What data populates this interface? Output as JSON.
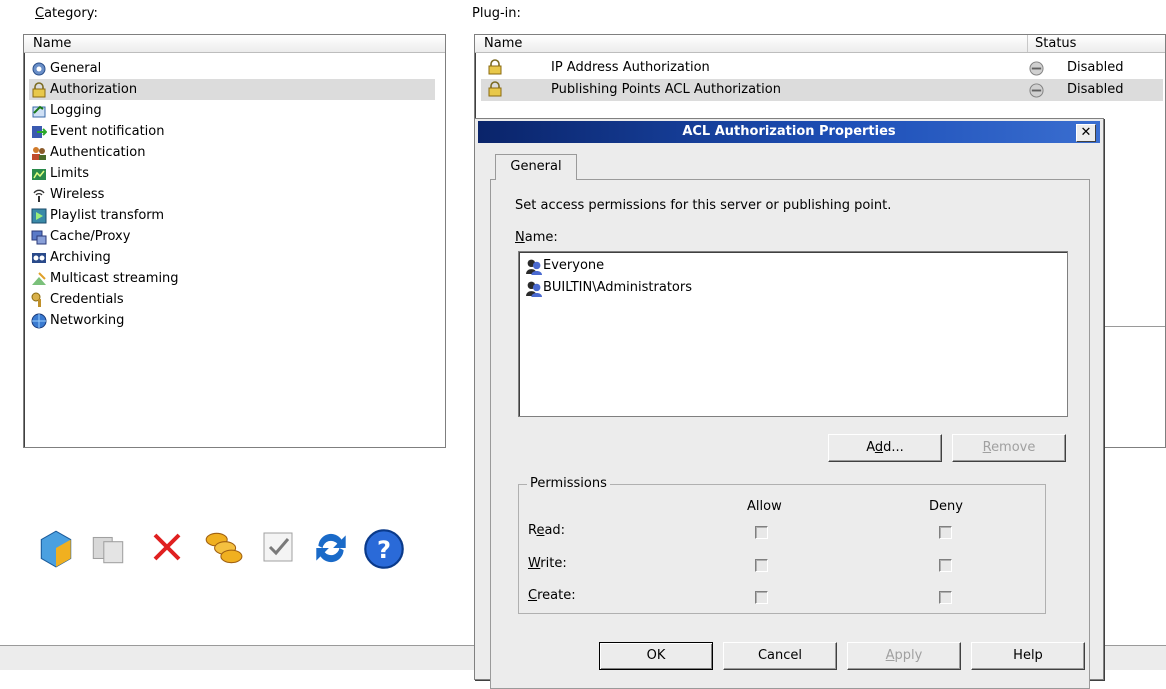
{
  "category": {
    "label": "Category:",
    "label_underline": "C",
    "label_rest": "ategory:",
    "column_name": "Name",
    "items": [
      {
        "label": "General",
        "icon": "gear-icon"
      },
      {
        "label": "Authorization",
        "icon": "padlock-icon"
      },
      {
        "label": "Logging",
        "icon": "log-icon"
      },
      {
        "label": "Event notification",
        "icon": "event-icon"
      },
      {
        "label": "Authentication",
        "icon": "users-icon"
      },
      {
        "label": "Limits",
        "icon": "limits-icon"
      },
      {
        "label": "Wireless",
        "icon": "wireless-icon"
      },
      {
        "label": "Playlist transform",
        "icon": "playlist-icon"
      },
      {
        "label": "Cache/Proxy",
        "icon": "cache-icon"
      },
      {
        "label": "Archiving",
        "icon": "archive-icon"
      },
      {
        "label": "Multicast streaming",
        "icon": "multicast-icon"
      },
      {
        "label": "Credentials",
        "icon": "key-icon"
      },
      {
        "label": "Networking",
        "icon": "network-icon"
      }
    ],
    "selected": "Authorization"
  },
  "plugin": {
    "label": "Plug-in:",
    "column_name": "Name",
    "column_status": "Status",
    "rows": [
      {
        "name": "IP Address Authorization",
        "status": "Disabled"
      },
      {
        "name": "Publishing Points ACL Authorization",
        "status": "Disabled"
      }
    ]
  },
  "dialog": {
    "title": "ACL Authorization Properties",
    "close_glyph": "✕",
    "tab_general": "General",
    "description": "Set access permissions for this server or publishing point.",
    "name_label_u": "N",
    "name_label_rest": "ame:",
    "principals": [
      "Everyone",
      "BUILTIN\\Administrators"
    ],
    "add_u": "d",
    "add_pre": "A",
    "add_post": "d...",
    "remove_u": "R",
    "remove_rest": "emove",
    "permissions_legend": "Permissions",
    "allow_label": "Allow",
    "deny_label": "Deny",
    "read": {
      "u": "e",
      "pre": "R",
      "post": "ad:"
    },
    "write": {
      "u": "W",
      "pre": "",
      "post": "rite:"
    },
    "create": {
      "u": "C",
      "pre": "",
      "post": "reate:"
    },
    "ok_label": "OK",
    "cancel_label": "Cancel",
    "apply_u": "A",
    "apply_rest": "pply",
    "help_label": "Help"
  },
  "colors": {
    "title_bar": "#0a246a",
    "selection": "#dcdcdc",
    "dialog_bg": "#ececec"
  }
}
